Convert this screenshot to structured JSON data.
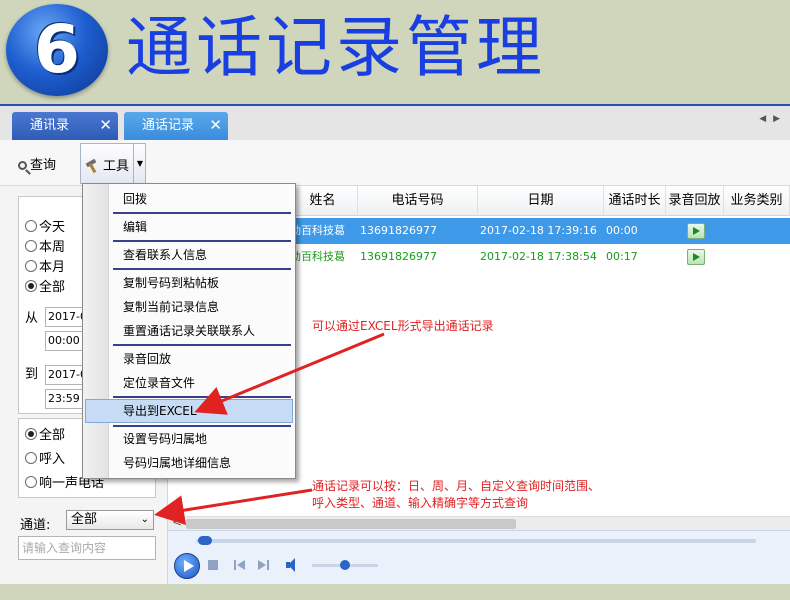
{
  "slide": {
    "step_number": "6",
    "title": "通话记录管理"
  },
  "tabs": [
    {
      "label": "通讯录",
      "close": "✕"
    },
    {
      "label": "通话记录",
      "close": "✕"
    }
  ],
  "tab_scroll": "◀ ▶",
  "toolbar": {
    "search_label": "查询",
    "tools_label": "工具",
    "tools_arrow": "▼"
  },
  "filter": {
    "period_options": [
      "今天",
      "本周",
      "本月",
      "全部"
    ],
    "period_selected": "全部",
    "from_label": "从",
    "from_date": "2017-0",
    "from_time": "00:00",
    "to_label": "到",
    "to_date": "2017-0",
    "to_time": "23:59",
    "call_types": [
      "全部",
      "呼入",
      "响一声电话"
    ],
    "call_type_selected": "全部",
    "channel_label": "通道:",
    "channel_value": "全部",
    "channel_arrow": "⌄",
    "search_placeholder": "请输入查询内容"
  },
  "grid": {
    "columns": [
      "姓名",
      "电话号码",
      "日期",
      "通话时长",
      "录音回放",
      "业务类别"
    ],
    "rows": [
      {
        "name": "劲百科技葛",
        "phone": "13691826977",
        "date": "2017-02-18 17:39:16",
        "duration": "00:00",
        "selected": true
      },
      {
        "name": "劲百科技葛",
        "phone": "13691826977",
        "date": "2017-02-18 17:38:54",
        "duration": "00:17",
        "selected": false
      }
    ],
    "h_scroll_left": "<"
  },
  "context_menu": {
    "items": [
      "回拨",
      "编辑",
      "查看联系人信息",
      "复制号码到粘帖板",
      "复制当前记录信息",
      "重置通话记录关联联系人",
      "录音回放",
      "定位录音文件",
      "导出到EXCEL",
      "设置号码归属地",
      "号码归属地详细信息"
    ],
    "highlighted": "导出到EXCEL"
  },
  "annotations": {
    "export_note": "可以通过EXCEL形式导出通话记录",
    "query_note_line1": "通话记录可以按：日、周、月、自定义查询时间范围、",
    "query_note_line2": "呼入类型、通道、输入精确字等方式查询"
  },
  "colors": {
    "slide_bg": "#cfd6bc",
    "title_blue": "#1a3fe0",
    "selected_row": "#3e9ae8",
    "row_text_green": "#1b9a1b",
    "annotation_red": "#e02222"
  }
}
